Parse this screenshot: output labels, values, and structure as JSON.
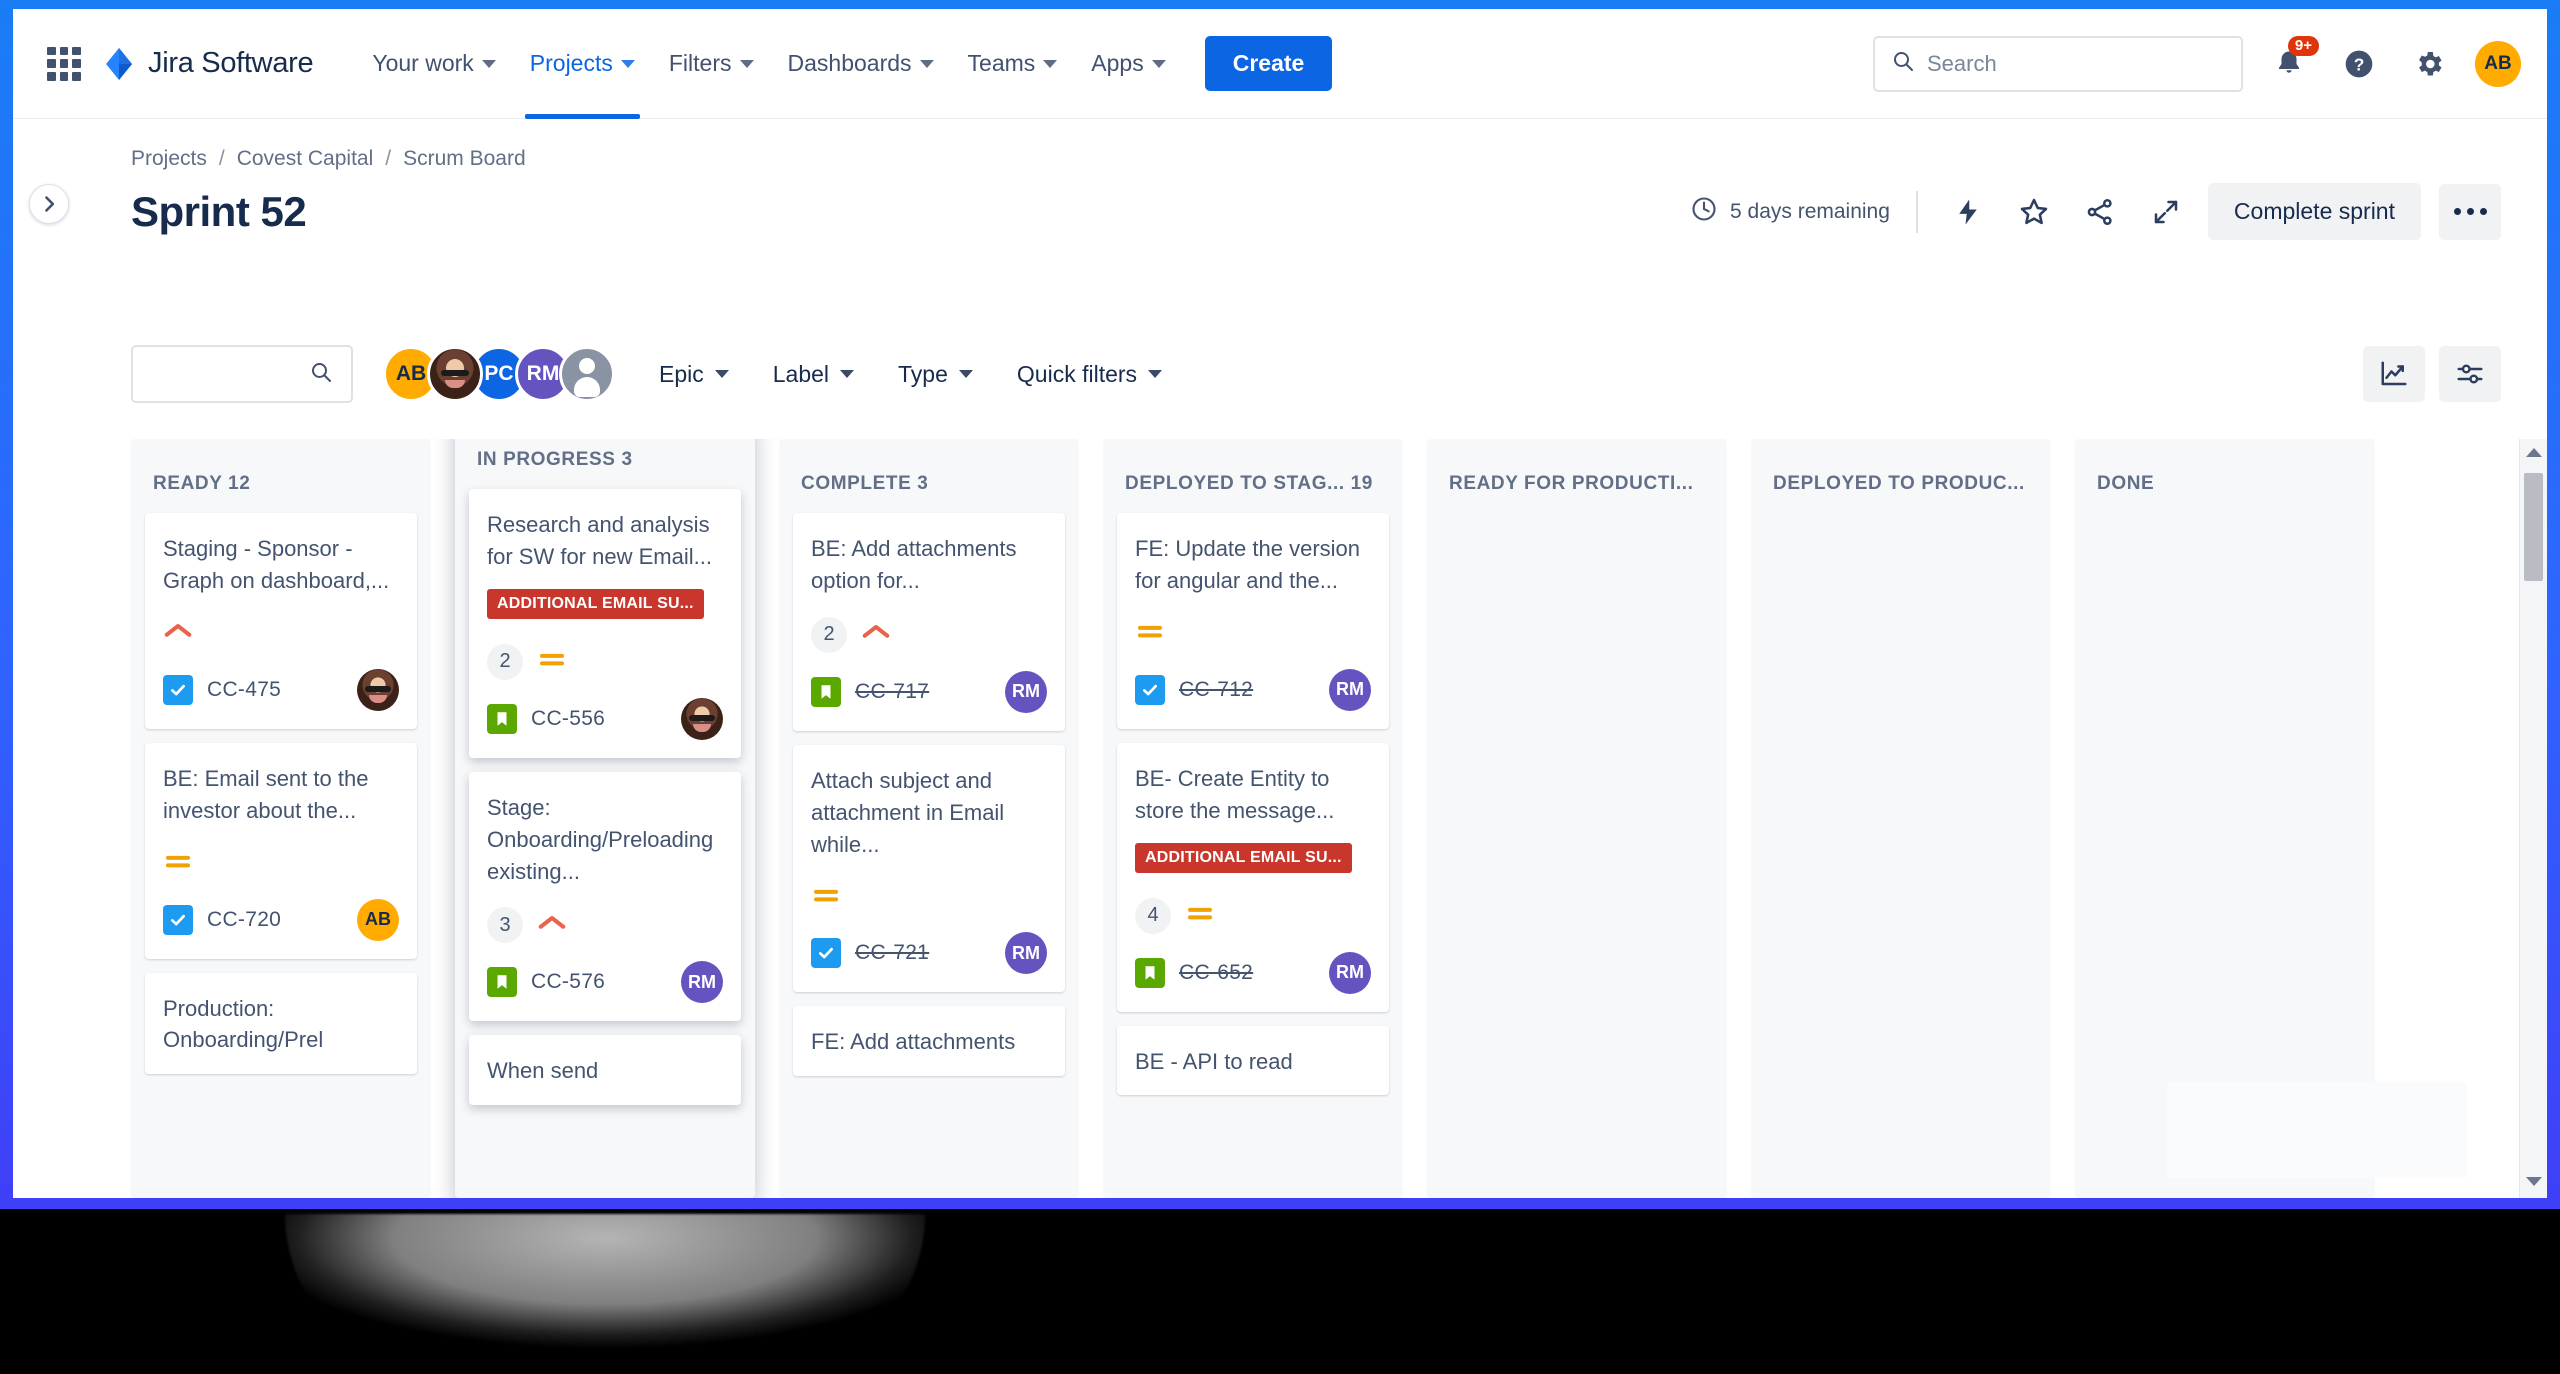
{
  "topnav": {
    "app_switcher_icon": "grid-apps-icon",
    "brand": "Jira Software",
    "brand_logo_icon": "jira-logo-icon",
    "items": [
      {
        "label": "Your work",
        "active": false
      },
      {
        "label": "Projects",
        "active": true
      },
      {
        "label": "Filters",
        "active": false
      },
      {
        "label": "Dashboards",
        "active": false
      },
      {
        "label": "Teams",
        "active": false
      },
      {
        "label": "Apps",
        "active": false
      }
    ],
    "create_label": "Create",
    "search_placeholder": "Search",
    "search_value": "",
    "notifications_badge": "9+",
    "notifications_icon": "bell-icon",
    "help_icon": "help-circle-icon",
    "settings_icon": "gear-icon",
    "profile_initials": "AB"
  },
  "page": {
    "expander_icon": "chevron-right-icon",
    "breadcrumb": [
      "Projects",
      "Covest Capital",
      "Scrum Board"
    ],
    "breadcrumb_separator": "/",
    "title": "Sprint 52",
    "days_remaining": "5 days remaining",
    "clock_icon": "clock-icon",
    "lightning_icon": "lightning-bolt-icon",
    "star_icon": "star-icon",
    "share_icon": "share-icon",
    "expand_icon": "expand-arrows-icon",
    "complete_sprint_label": "Complete sprint",
    "more_icon": "ellipsis-icon"
  },
  "filterbar": {
    "search_value": "",
    "search_placeholder": "",
    "search_icon": "search-icon",
    "avatars": [
      {
        "initials": "AB",
        "style": "av-ab",
        "name": "avatar-ab"
      },
      {
        "initials": "",
        "style": "av-photo",
        "name": "avatar-photo"
      },
      {
        "initials": "PC",
        "style": "av-pc",
        "name": "avatar-pc"
      },
      {
        "initials": "RM",
        "style": "av-rm",
        "name": "avatar-rm"
      },
      {
        "initials": "",
        "style": "av-anon",
        "name": "avatar-unassigned"
      }
    ],
    "dropdowns": [
      "Epic",
      "Label",
      "Type",
      "Quick filters"
    ],
    "insights_icon": "chart-insights-icon",
    "board_settings_icon": "sliders-icon"
  },
  "board": {
    "columns": [
      {
        "header": "READY 12",
        "dragging": false,
        "cards": [
          {
            "title": "Staging - Sponsor - Graph on dashboard,...",
            "epic": null,
            "count": null,
            "priority": "high",
            "type": "task",
            "key": "CC-475",
            "key_done": false,
            "avatar": "av-sm-photo",
            "avatar_initials": ""
          },
          {
            "title": "BE: Email sent to the investor about the...",
            "epic": null,
            "count": null,
            "priority": "medium",
            "type": "task",
            "key": "CC-720",
            "key_done": false,
            "avatar": "av-sm-ab",
            "avatar_initials": "AB"
          },
          {
            "title": "Production: Onboarding/Prel",
            "epic": null,
            "count": null,
            "priority": null,
            "type": null,
            "key": "",
            "key_done": false,
            "avatar": null,
            "avatar_initials": ""
          }
        ]
      },
      {
        "header": "IN PROGRESS 3",
        "dragging": true,
        "cards": [
          {
            "title": "Research and analysis for SW for new Email...",
            "epic": "ADDITIONAL EMAIL SU...",
            "count": "2",
            "priority": "medium",
            "type": "story",
            "key": "CC-556",
            "key_done": false,
            "avatar": "av-sm-photo",
            "avatar_initials": ""
          },
          {
            "title": "Stage: Onboarding/Preloading existing...",
            "epic": null,
            "count": "3",
            "priority": "high",
            "type": "story",
            "key": "CC-576",
            "key_done": false,
            "avatar": "av-sm-rm",
            "avatar_initials": "RM"
          },
          {
            "title": "When send",
            "epic": null,
            "count": null,
            "priority": null,
            "type": null,
            "key": "",
            "key_done": false,
            "avatar": null,
            "avatar_initials": ""
          }
        ]
      },
      {
        "header": "COMPLETE 3",
        "dragging": false,
        "cards": [
          {
            "title": "BE: Add attachments option for...",
            "epic": null,
            "count": "2",
            "priority": "high",
            "type": "story",
            "key": "CC-717",
            "key_done": true,
            "avatar": "av-sm-rm",
            "avatar_initials": "RM"
          },
          {
            "title": "Attach subject and attachment in Email while...",
            "epic": null,
            "count": null,
            "priority": "medium",
            "type": "task",
            "key": "CC-721",
            "key_done": true,
            "avatar": "av-sm-rm",
            "avatar_initials": "RM"
          },
          {
            "title": "FE: Add attachments",
            "epic": null,
            "count": null,
            "priority": null,
            "type": null,
            "key": "",
            "key_done": false,
            "avatar": null,
            "avatar_initials": ""
          }
        ]
      },
      {
        "header": "DEPLOYED TO STAG... 19",
        "dragging": false,
        "cards": [
          {
            "title": "FE: Update the version for angular and the...",
            "epic": null,
            "count": null,
            "priority": "medium",
            "type": "task",
            "key": "CC-712",
            "key_done": true,
            "avatar": "av-sm-rm",
            "avatar_initials": "RM"
          },
          {
            "title": "BE- Create Entity to store the message...",
            "epic": "ADDITIONAL EMAIL SU...",
            "count": "4",
            "priority": "medium",
            "type": "story",
            "key": "CC-652",
            "key_done": true,
            "avatar": "av-sm-rm",
            "avatar_initials": "RM"
          },
          {
            "title": "BE - API to read",
            "epic": null,
            "count": null,
            "priority": null,
            "type": null,
            "key": "",
            "key_done": false,
            "avatar": null,
            "avatar_initials": ""
          }
        ]
      },
      {
        "header": "READY FOR PRODUCTI...",
        "dragging": false,
        "cards": []
      },
      {
        "header": "DEPLOYED TO PRODUC...",
        "dragging": false,
        "cards": []
      },
      {
        "header": "DONE",
        "dragging": false,
        "cards": []
      }
    ]
  },
  "colors": {
    "brand_blue": "#0c66e4",
    "epic_red": "#c9372c",
    "priority_high": "#e9634b",
    "priority_medium": "#f0a202",
    "task_blue": "#1d9bf0",
    "story_green": "#5aa700",
    "avatar_orange": "#ffab00",
    "avatar_purple": "#6554c0"
  }
}
